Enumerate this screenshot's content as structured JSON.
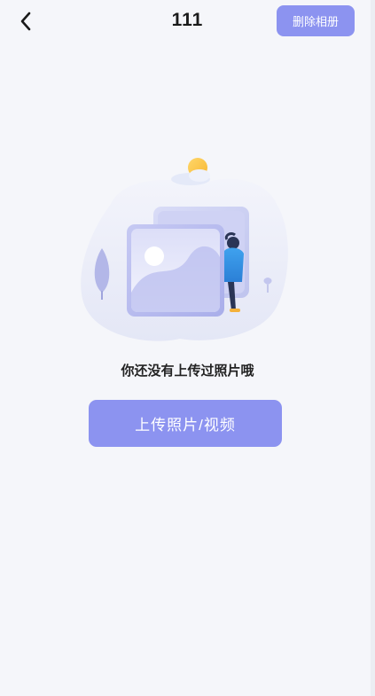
{
  "header": {
    "title": "111",
    "back_icon": "chevron-left-icon",
    "delete_album_label": "删除相册"
  },
  "empty_state": {
    "illustration": "empty-photo-album-illustration",
    "message": "你还没有上传过照片哦",
    "upload_button_label": "上传照片/视频"
  },
  "colors": {
    "background": "#f5f6fa",
    "accent": "#8c93f0",
    "title_text": "#1a1a1a"
  }
}
